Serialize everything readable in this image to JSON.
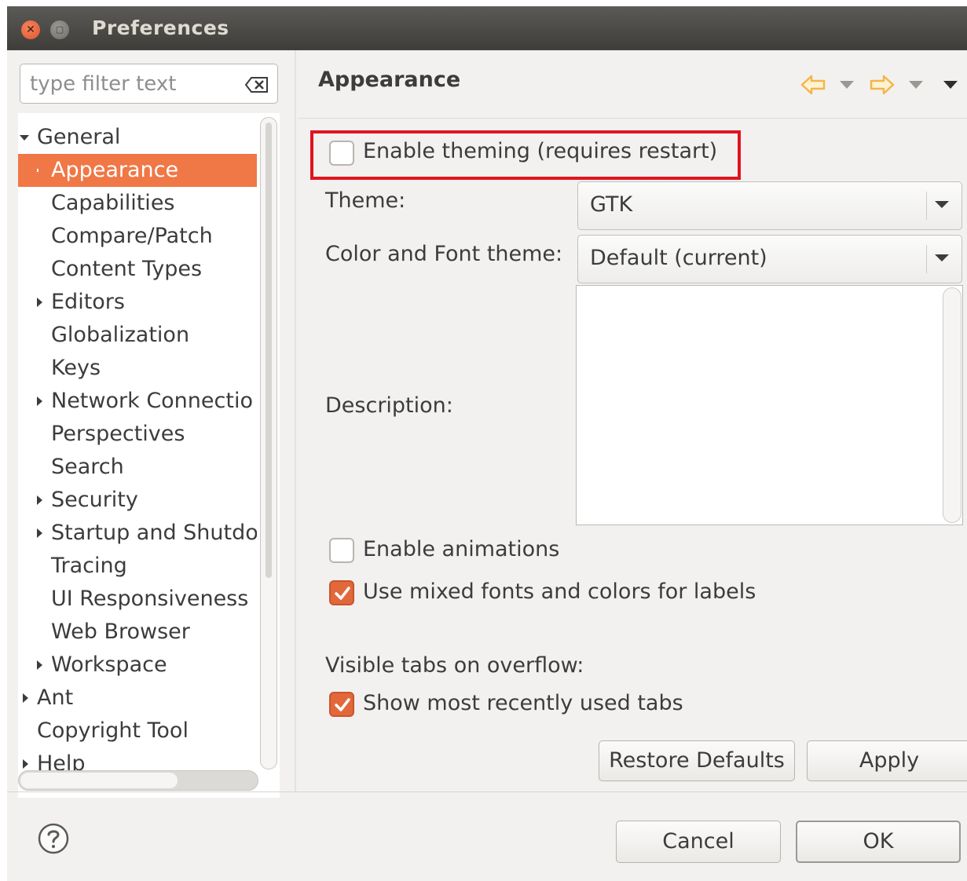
{
  "window": {
    "title": "Preferences"
  },
  "sidebar": {
    "filter_placeholder": "type filter text",
    "items": [
      {
        "label": "General",
        "expander": "expanded",
        "indent": 0
      },
      {
        "label": "Appearance",
        "expander": "none",
        "indent": 1,
        "selected": true
      },
      {
        "label": "Capabilities",
        "expander": "none",
        "indent": 1
      },
      {
        "label": "Compare/Patch",
        "expander": "none",
        "indent": 1
      },
      {
        "label": "Content Types",
        "expander": "none",
        "indent": 1
      },
      {
        "label": "Editors",
        "expander": "collapsed",
        "indent": 1
      },
      {
        "label": "Globalization",
        "expander": "none",
        "indent": 1
      },
      {
        "label": "Keys",
        "expander": "none",
        "indent": 1
      },
      {
        "label": "Network Connectio",
        "expander": "collapsed",
        "indent": 1
      },
      {
        "label": "Perspectives",
        "expander": "none",
        "indent": 1
      },
      {
        "label": "Search",
        "expander": "none",
        "indent": 1
      },
      {
        "label": "Security",
        "expander": "collapsed",
        "indent": 1
      },
      {
        "label": "Startup and Shutdo",
        "expander": "collapsed",
        "indent": 1
      },
      {
        "label": "Tracing",
        "expander": "none",
        "indent": 1
      },
      {
        "label": "UI Responsiveness M",
        "expander": "none",
        "indent": 1
      },
      {
        "label": "Web Browser",
        "expander": "none",
        "indent": 1
      },
      {
        "label": "Workspace",
        "expander": "collapsed",
        "indent": 1
      },
      {
        "label": "Ant",
        "expander": "collapsed",
        "indent": 0
      },
      {
        "label": "Copyright Tool",
        "expander": "none",
        "indent": 0
      },
      {
        "label": "Help",
        "expander": "collapsed",
        "indent": 0
      }
    ]
  },
  "page": {
    "title": "Appearance",
    "enable_theming": {
      "label": "Enable theming (requires restart)",
      "checked": false
    },
    "theme": {
      "label": "Theme:",
      "value": "GTK"
    },
    "color_font_theme": {
      "label": "Color and Font theme:",
      "value": "Default (current)"
    },
    "description": {
      "label": "Description:",
      "value": ""
    },
    "enable_animations": {
      "label": "Enable animations",
      "checked": false
    },
    "mixed_fonts": {
      "label": "Use mixed fonts and colors for labels",
      "checked": true
    },
    "visible_tabs_label": "Visible tabs on overflow:",
    "show_mru_tabs": {
      "label": "Show most recently used tabs",
      "checked": true
    },
    "restore_defaults_label": "Restore Defaults",
    "apply_label": "Apply"
  },
  "footer": {
    "cancel_label": "Cancel",
    "ok_label": "OK"
  },
  "colors": {
    "selection": "#f07746",
    "checkbox_checked": "#e2683c",
    "highlight_box": "#e0141f",
    "nav_arrow": "#f3b64a",
    "titlebar": "#3e3d39"
  },
  "icons": [
    "close-icon",
    "maximize-icon",
    "clear-filter-icon",
    "back-arrow-icon",
    "forward-arrow-icon",
    "view-menu-icon",
    "help-icon"
  ]
}
